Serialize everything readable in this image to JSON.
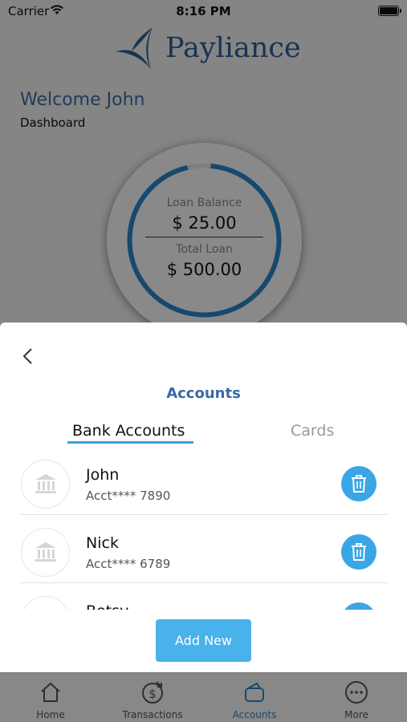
{
  "status_bar": {
    "carrier": "Carrier",
    "time": "8:16 PM"
  },
  "app": {
    "logo_text": "Payliance"
  },
  "dashboard": {
    "welcome": "Welcome John",
    "subtitle": "Dashboard",
    "loan_balance_label": "Loan Balance",
    "loan_balance_value": "$ 25.00",
    "total_loan_label": "Total Loan",
    "total_loan_value": "$ 500.00",
    "gauge_fraction": 0.95,
    "accent_color": "#2b85c8"
  },
  "sheet": {
    "title": "Accounts",
    "segments": [
      {
        "label": "Bank Accounts",
        "selected": true
      },
      {
        "label": "Cards",
        "selected": false
      }
    ],
    "accounts": [
      {
        "name": "John",
        "account": "Acct**** 7890",
        "icon": "bank-icon"
      },
      {
        "name": "Nick",
        "account": "Acct**** 6789",
        "icon": "bank-icon"
      },
      {
        "name": "Betsy",
        "account": "",
        "icon": "bank-icon"
      }
    ],
    "add_button": "Add New"
  },
  "tabbar": {
    "items": [
      {
        "label": "Home",
        "icon": "home-icon",
        "active": false
      },
      {
        "label": "Transactions",
        "icon": "dollar-transfer-icon",
        "active": false
      },
      {
        "label": "Accounts",
        "icon": "wallet-icon",
        "active": true
      },
      {
        "label": "More",
        "icon": "more-dots-icon",
        "active": false
      }
    ]
  }
}
